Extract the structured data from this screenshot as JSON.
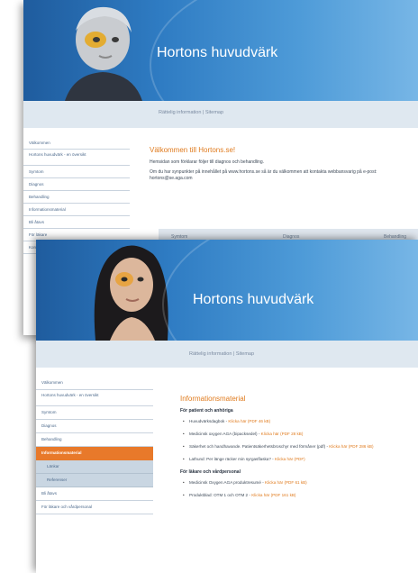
{
  "back": {
    "title": "Hortons huvudvärk",
    "topnav": "Rättelig information | Sitemap",
    "nav": [
      "Välkommen",
      "Hortons huvudvärk - en översikt",
      "Symtom",
      "Diagnos",
      "Behandling",
      "Informationsmaterial",
      "Bli åtavs",
      "För läkare",
      "Kontakt"
    ],
    "heading": "Välkommen till Hortons.se!",
    "para1": "Hemsidan som förklarar följer till diagnos och behandling.",
    "para2": "Om du har synpunkter på innehållet på www.hortons.se så är du välkommen att kontakta webbansvarig på e-post: hortons@se.aga.com",
    "tabs": [
      "Symtom",
      "Diagnos",
      "Behandling"
    ]
  },
  "front": {
    "title": "Hortons huvudvärk",
    "topnav": "Rättelig information | Sitemap",
    "nav": [
      {
        "label": "Välkommen",
        "type": "item"
      },
      {
        "label": "Hortons huvudvärk - en översikt",
        "type": "tall"
      },
      {
        "label": "Symtom",
        "type": "item"
      },
      {
        "label": "Diagnos",
        "type": "item"
      },
      {
        "label": "Behandling",
        "type": "item"
      },
      {
        "label": "Informationsmaterial",
        "type": "active"
      },
      {
        "label": "Länkar",
        "type": "sub"
      },
      {
        "label": "Referenser",
        "type": "sub"
      },
      {
        "label": "Bli åtavs",
        "type": "item"
      },
      {
        "label": "För läkare och vårdpersonal",
        "type": "item"
      }
    ],
    "heading": "Informationsmaterial",
    "section1": "För patient och anhöriga",
    "bullets1": [
      {
        "text": "Huvudvärksdagbok - ",
        "link": "Klicka här (PDF 46 kB)"
      },
      {
        "text": "Medicinsk oxygen AGA (bipacksedel) - ",
        "link": "Klicka här (PDF 28 kB)"
      },
      {
        "text": "Säkerhet och handhavande. Patientsäkerhetsbroschyr med förmåner (pdf) - ",
        "link": "Klicka här (PDF 286 kB)"
      },
      {
        "text": "Lathund: Per länge räcker min syrgasflaska? - ",
        "link": "Klicka här (PDF)"
      }
    ],
    "section2": "För läkare och vårdpersonal",
    "bullets2": [
      {
        "text": "Medicinsk Oxygen AGA produktresumé - ",
        "link": "Klicka här (PDF 61 kB)"
      },
      {
        "text": "Produktblad: OTM 1 och OTM 2 - ",
        "link": "Klicka här (PDF 161 kB)"
      }
    ]
  },
  "colors": {
    "accent": "#e8792a",
    "banner": "#2f7cc3",
    "nav_text": "#4d6a8c"
  }
}
